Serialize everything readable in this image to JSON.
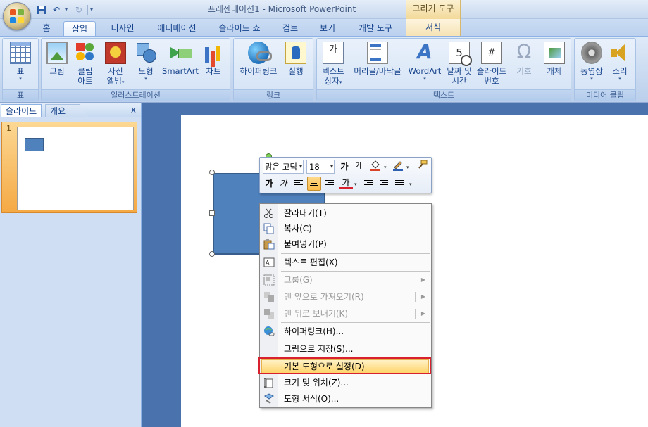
{
  "window": {
    "title": "프레젠테이션1 - Microsoft PowerPoint",
    "context_tab_header": "그리기 도구"
  },
  "tabs": [
    {
      "label": "홈"
    },
    {
      "label": "삽입",
      "active": true
    },
    {
      "label": "디자인"
    },
    {
      "label": "애니메이션"
    },
    {
      "label": "슬라이드 쇼"
    },
    {
      "label": "검토"
    },
    {
      "label": "보기"
    },
    {
      "label": "개발 도구"
    },
    {
      "label": "서식",
      "context": true
    }
  ],
  "ribbon": {
    "groups": {
      "table": "표",
      "illustrations": "일러스트레이션",
      "links": "링크",
      "text": "텍스트",
      "media": "미디어 클립"
    },
    "buttons": {
      "table": "표",
      "picture": "그림",
      "clipart_1": "클립",
      "clipart_2": "아트",
      "album_1": "사진",
      "album_2": "앨범",
      "shapes": "도형",
      "smartart": "SmartArt",
      "chart": "차트",
      "hyperlink": "하이퍼링크",
      "action": "실행",
      "textbox_1": "텍스트",
      "textbox_2": "상자",
      "textbox_icon": "가",
      "header_footer": "머리글/바닥글",
      "wordart": "WordArt",
      "datetime_1": "날짜 및",
      "datetime_2": "시간",
      "datetime_icon": "5",
      "slidenum_1": "슬라이드",
      "slidenum_2": "번호",
      "slidenum_icon": "#",
      "symbol": "기호",
      "symbol_icon": "Ω",
      "object": "개체",
      "movie": "동영상",
      "sound": "소리"
    }
  },
  "left_pane": {
    "tab_slides": "슬라이드",
    "tab_outline": "개요",
    "close": "x",
    "slide_number": "1"
  },
  "mini_toolbar": {
    "font": "맑은 고딕",
    "size": "18",
    "grow": "가",
    "shrink": "가",
    "bold": "가",
    "italic": "가",
    "font_color": "가"
  },
  "context_menu": {
    "items": {
      "cut": "잘라내기(T)",
      "copy": "복사(C)",
      "paste": "붙여넣기(P)",
      "edit_text": "텍스트 편집(X)",
      "group": "그룹(G)",
      "bring_front": "맨 앞으로 가져오기(R)",
      "send_back": "맨 뒤로 보내기(K)",
      "hyperlink": "하이퍼링크(H)...",
      "save_picture": "그림으로 저장(S)...",
      "set_default": "기본 도형으로 설정(D)",
      "size_position": "크기 및 위치(Z)...",
      "format_shape": "도형 서식(O)..."
    }
  },
  "colors": {
    "shape_fill": "#4f81bd",
    "highlight_box": "#d9202e"
  }
}
